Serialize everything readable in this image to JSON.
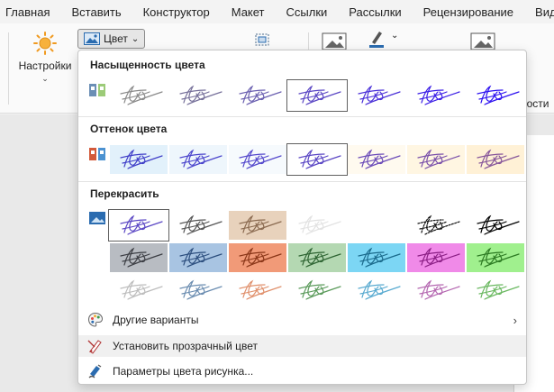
{
  "tabs": [
    "Главная",
    "Вставить",
    "Конструктор",
    "Макет",
    "Ссылки",
    "Рассылки",
    "Рецензирование",
    "Вид"
  ],
  "ribbon": {
    "settings_label": "Настройки",
    "color_button_label": "Цвет",
    "partial_label": "ности"
  },
  "dropdown": {
    "saturation_title": "Насыщенность цвета",
    "tone_title": "Оттенок цвета",
    "recolor_title": "Перекрасить",
    "more_variants": "Другие варианты",
    "set_transparent": "Установить прозрачный цвет",
    "picture_color_options": "Параметры цвета рисунка..."
  },
  "palettes": {
    "saturation": [
      {
        "bg": "#ffffff",
        "ink": "#8a8a8a"
      },
      {
        "bg": "#ffffff",
        "ink": "#76709a"
      },
      {
        "bg": "#ffffff",
        "ink": "#6a5fb0"
      },
      {
        "bg": "#ffffff",
        "ink": "#5a46c4",
        "selected": true
      },
      {
        "bg": "#ffffff",
        "ink": "#4a30d8"
      },
      {
        "bg": "#ffffff",
        "ink": "#3a1de6"
      },
      {
        "bg": "#ffffff",
        "ink": "#2c10f0"
      }
    ],
    "tone": [
      {
        "bg": "#e2f1fb",
        "ink": "#3f3ec8"
      },
      {
        "bg": "#eef6fc",
        "ink": "#4a44cc"
      },
      {
        "bg": "#f6fafd",
        "ink": "#5448cc"
      },
      {
        "bg": "#ffffff",
        "ink": "#5a46c4",
        "selected": true
      },
      {
        "bg": "#fffaef",
        "ink": "#6a4ab8"
      },
      {
        "bg": "#fff6e2",
        "ink": "#7a50aa"
      },
      {
        "bg": "#fff1d6",
        "ink": "#86559a"
      }
    ],
    "recolor": [
      [
        {
          "bg": "#ffffff",
          "ink": "#5a46c4",
          "selected": true
        },
        {
          "bg": "#ffffff",
          "ink": "#555555"
        },
        {
          "bg": "#e8d2bc",
          "ink": "#8a6a50"
        },
        {
          "bg": "#ffffff",
          "ink": "#e2e2e2"
        },
        {
          "bg": "#ffffff",
          "ink": "#ffffff"
        },
        {
          "bg": "#ffffff",
          "ink": "#111111",
          "dashed": true
        },
        {
          "bg": "#ffffff",
          "ink": "#000000"
        }
      ],
      [
        {
          "bg": "#b8bcc2",
          "ink": "#3c3e44"
        },
        {
          "bg": "#a8c4e2",
          "ink": "#2c4e7e"
        },
        {
          "bg": "#f19a78",
          "ink": "#8a3618"
        },
        {
          "bg": "#b4d8b2",
          "ink": "#2e6432"
        },
        {
          "bg": "#7cd6f4",
          "ink": "#1a6a8c"
        },
        {
          "bg": "#f08ae8",
          "ink": "#8a1e84"
        },
        {
          "bg": "#a0f08e",
          "ink": "#2c7a22"
        }
      ],
      [
        {
          "bg": "#ffffff",
          "ink": "#bcbcbc"
        },
        {
          "bg": "#ffffff",
          "ink": "#6a8cb0"
        },
        {
          "bg": "#ffffff",
          "ink": "#e0906c"
        },
        {
          "bg": "#ffffff",
          "ink": "#5a9a5a"
        },
        {
          "bg": "#ffffff",
          "ink": "#58aad0"
        },
        {
          "bg": "#ffffff",
          "ink": "#b466b0"
        },
        {
          "bg": "#ffffff",
          "ink": "#6ab860"
        }
      ]
    ]
  },
  "icons": {
    "settings": "sun-icon",
    "color": "picture-color-icon",
    "more_variants": "palette-icon",
    "set_transparent": "transparent-pen-icon",
    "picture_color_options": "format-picture-icon"
  }
}
